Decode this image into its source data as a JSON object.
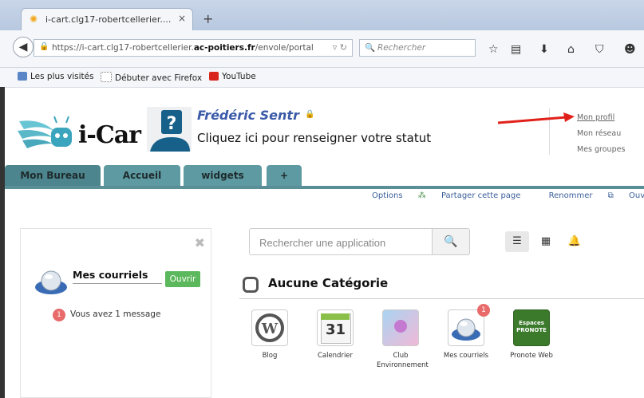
{
  "browser": {
    "tab_title": "i-cart.clg17-robertcellerier....",
    "tab_close": "×",
    "new_tab": "+",
    "url_prefix": "https://i-cart.clg17-robertcellerier.",
    "url_domain": "ac-poitiers.fr",
    "url_suffix": "/envole/portal",
    "search_placeholder": "Rechercher",
    "bookmarks": [
      {
        "label": "Les plus visités"
      },
      {
        "label": "Débuter avec Firefox"
      },
      {
        "label": "YouTube"
      }
    ]
  },
  "header": {
    "logo_text": "i-Car",
    "username": "Frédéric Sentr",
    "status_prompt": "Cliquez ici pour renseigner votre statut",
    "profile_links": [
      "Mon profil",
      "Mon réseau",
      "Mes groupes"
    ]
  },
  "tabs": [
    {
      "label": "Mon Bureau"
    },
    {
      "label": "Accueil"
    },
    {
      "label": "widgets"
    },
    {
      "label": "+"
    }
  ],
  "actions": [
    "Options",
    "Partager cette page",
    "Renommer",
    "Ouvrir le si"
  ],
  "widget": {
    "title": "Mes courriels",
    "open_label": "Ouvrir",
    "badge_count": "1",
    "message": "Vous avez 1 message"
  },
  "app_search": {
    "placeholder": "Rechercher une application"
  },
  "category": {
    "title": "Aucune Catégorie"
  },
  "apps": [
    {
      "label": "Blog"
    },
    {
      "label": "Calendrier"
    },
    {
      "label": "Club Environnement"
    },
    {
      "label": "Mes courriels",
      "badge": "1"
    },
    {
      "label": "Pronote Web"
    }
  ],
  "calendar_day": "31",
  "pronote_text": "Espaces PRONOTE",
  "colors": {
    "tab": "#5e9aa2",
    "accent_green": "#5cb85c",
    "badge": "#e86a6a",
    "link": "#3a5f9a"
  }
}
